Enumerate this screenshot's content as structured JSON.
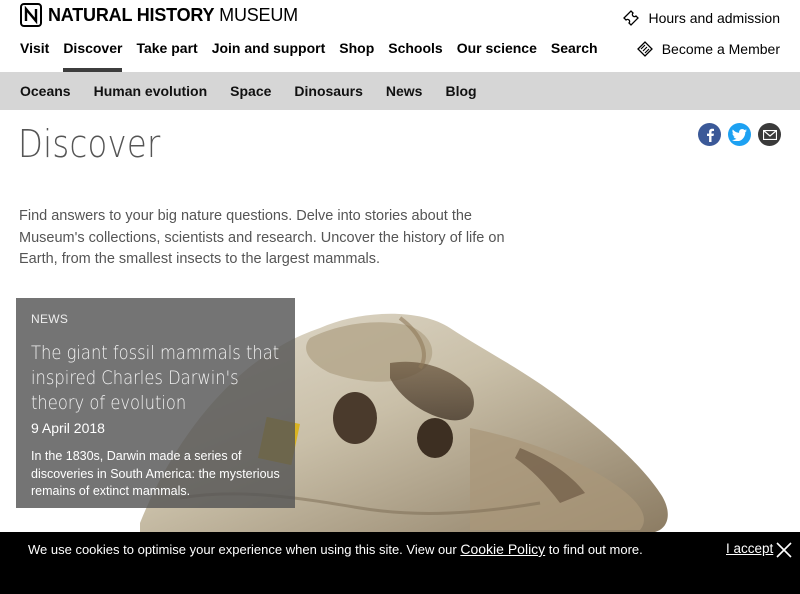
{
  "header": {
    "logo_bold": "NATURAL HISTORY",
    "logo_light": "MUSEUM",
    "nav": [
      {
        "label": "Visit"
      },
      {
        "label": "Discover",
        "active": true
      },
      {
        "label": "Take part"
      },
      {
        "label": "Join and support"
      },
      {
        "label": "Shop"
      },
      {
        "label": "Schools"
      },
      {
        "label": "Our science"
      },
      {
        "label": "Search"
      }
    ],
    "hours_label": "Hours and admission",
    "member_label": "Become a Member"
  },
  "subnav": {
    "items": [
      "Oceans",
      "Human evolution",
      "Space",
      "Dinosaurs",
      "News",
      "Blog"
    ]
  },
  "page": {
    "title": "Discover",
    "intro": "Find answers to your big nature questions. Delve into stories about the Museum's collections, scientists and research. Uncover the history of life on Earth, from the smallest insects to the largest mammals."
  },
  "share": {
    "icons": [
      "facebook-icon",
      "twitter-icon",
      "email-icon"
    ]
  },
  "feature": {
    "tag": "NEWS",
    "headline": "The giant fossil mammals that inspired Charles Darwin's theory of evolution",
    "date": "9 April 2018",
    "summary": "In the 1830s, Darwin made a series of discoveries in South America: the mysterious remains of extinct mammals."
  },
  "cookie": {
    "message_before": "We use cookies to optimise your experience when using this site. View our ",
    "link": "Cookie Policy",
    "message_after": " to find out more.",
    "accept": "I accept"
  },
  "colors": {
    "subnav_bg": "#d6d6d6",
    "card_bg": "#555555",
    "cookie_bg": "#000000",
    "facebook": "#3b5998",
    "twitter": "#1da1f2"
  }
}
